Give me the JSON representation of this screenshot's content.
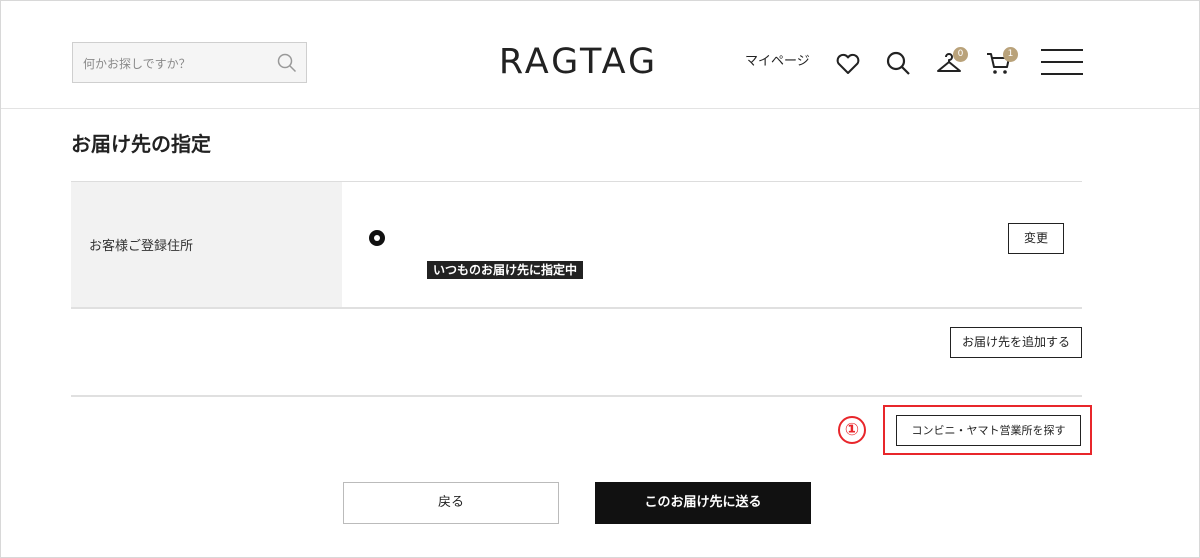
{
  "header": {
    "search_placeholder": "何かお探しですか？",
    "logo": "RAGTAG",
    "mypage": "マイページ",
    "hanger_badge": "0",
    "cart_badge": "1",
    "badge_color": "#b9a27a"
  },
  "page": {
    "title": "お届け先の指定"
  },
  "address_table": {
    "row_label": "お客様ご登録住所",
    "default_tag": "いつものお届け先に指定中",
    "change_button": "変更",
    "selected": true
  },
  "actions": {
    "add_address": "お届け先を追加する",
    "find_store": "コンビニ・ヤマト営業所を探す",
    "annotation_marker": "①",
    "back": "戻る",
    "submit": "このお届け先に送る"
  },
  "colors": {
    "accent_red": "#e8262b",
    "primary_button": "#111111"
  }
}
